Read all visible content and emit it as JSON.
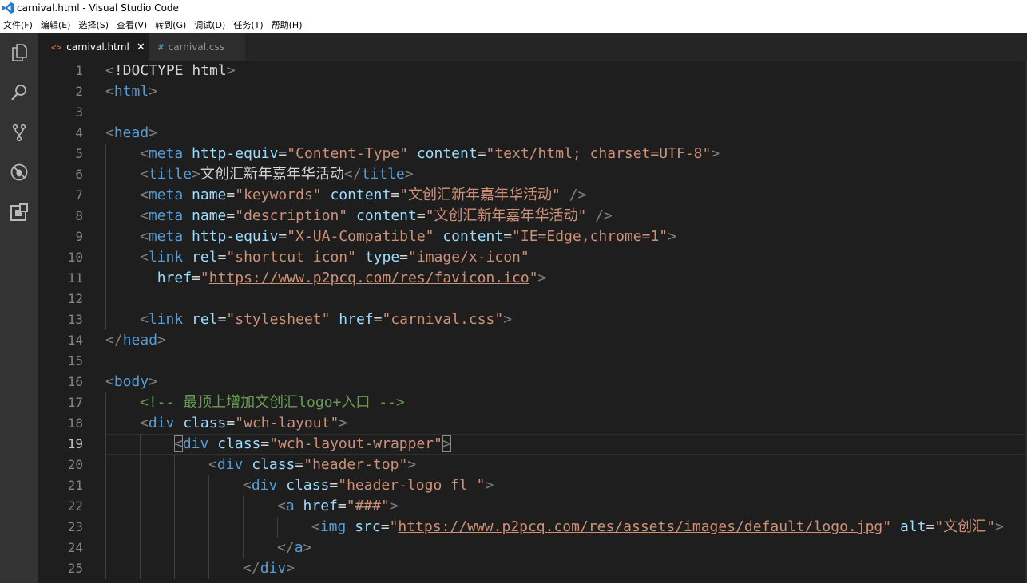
{
  "window": {
    "title": "carnival.html - Visual Studio Code"
  },
  "menu": [
    "文件(F)",
    "编辑(E)",
    "选择(S)",
    "查看(V)",
    "转到(G)",
    "调试(D)",
    "任务(T)",
    "帮助(H)"
  ],
  "activity": [
    "explorer-icon",
    "search-icon",
    "source-control-icon",
    "debug-icon",
    "extensions-icon"
  ],
  "tabs": [
    {
      "label": "carnival.html",
      "icon": "<>",
      "active": true,
      "close": "✕"
    },
    {
      "label": "carnival.css",
      "icon": "#",
      "active": false
    }
  ],
  "editor": {
    "current_line": 19,
    "lines": [
      {
        "n": "1",
        "indent": 0,
        "tokens": [
          [
            "punct",
            "<"
          ],
          [
            "text",
            "!DOCTYPE html"
          ],
          [
            "punct",
            ">"
          ]
        ]
      },
      {
        "n": "2",
        "indent": 0,
        "tokens": [
          [
            "punct",
            "<"
          ],
          [
            "tag",
            "html"
          ],
          [
            "punct",
            ">"
          ]
        ]
      },
      {
        "n": "3",
        "indent": 0,
        "tokens": []
      },
      {
        "n": "4",
        "indent": 0,
        "tokens": [
          [
            "punct",
            "<"
          ],
          [
            "tag",
            "head"
          ],
          [
            "punct",
            ">"
          ]
        ]
      },
      {
        "n": "5",
        "indent": 1,
        "tokens": [
          [
            "punct",
            "<"
          ],
          [
            "tag",
            "meta"
          ],
          [
            "text",
            " "
          ],
          [
            "attr",
            "http-equiv"
          ],
          [
            "text",
            "="
          ],
          [
            "str",
            "\"Content-Type\""
          ],
          [
            "text",
            " "
          ],
          [
            "attr",
            "content"
          ],
          [
            "text",
            "="
          ],
          [
            "str",
            "\"text/html; charset=UTF-8\""
          ],
          [
            "punct",
            ">"
          ]
        ]
      },
      {
        "n": "6",
        "indent": 1,
        "tokens": [
          [
            "punct",
            "<"
          ],
          [
            "tag",
            "title"
          ],
          [
            "punct",
            ">"
          ],
          [
            "text",
            "文创汇新年嘉年华活动"
          ],
          [
            "punct",
            "</"
          ],
          [
            "tag",
            "title"
          ],
          [
            "punct",
            ">"
          ]
        ]
      },
      {
        "n": "7",
        "indent": 1,
        "tokens": [
          [
            "punct",
            "<"
          ],
          [
            "tag",
            "meta"
          ],
          [
            "text",
            " "
          ],
          [
            "attr",
            "name"
          ],
          [
            "text",
            "="
          ],
          [
            "str",
            "\"keywords\""
          ],
          [
            "text",
            " "
          ],
          [
            "attr",
            "content"
          ],
          [
            "text",
            "="
          ],
          [
            "str",
            "\"文创汇新年嘉年华活动\""
          ],
          [
            "text",
            " "
          ],
          [
            "punct",
            "/>"
          ]
        ]
      },
      {
        "n": "8",
        "indent": 1,
        "tokens": [
          [
            "punct",
            "<"
          ],
          [
            "tag",
            "meta"
          ],
          [
            "text",
            " "
          ],
          [
            "attr",
            "name"
          ],
          [
            "text",
            "="
          ],
          [
            "str",
            "\"description\""
          ],
          [
            "text",
            " "
          ],
          [
            "attr",
            "content"
          ],
          [
            "text",
            "="
          ],
          [
            "str",
            "\"文创汇新年嘉年华活动\""
          ],
          [
            "text",
            " "
          ],
          [
            "punct",
            "/>"
          ]
        ]
      },
      {
        "n": "9",
        "indent": 1,
        "tokens": [
          [
            "punct",
            "<"
          ],
          [
            "tag",
            "meta"
          ],
          [
            "text",
            " "
          ],
          [
            "attr",
            "http-equiv"
          ],
          [
            "text",
            "="
          ],
          [
            "str",
            "\"X-UA-Compatible\""
          ],
          [
            "text",
            " "
          ],
          [
            "attr",
            "content"
          ],
          [
            "text",
            "="
          ],
          [
            "str",
            "\"IE=Edge,chrome=1\""
          ],
          [
            "punct",
            ">"
          ]
        ]
      },
      {
        "n": "10",
        "indent": 1,
        "tokens": [
          [
            "punct",
            "<"
          ],
          [
            "tag",
            "link"
          ],
          [
            "text",
            " "
          ],
          [
            "attr",
            "rel"
          ],
          [
            "text",
            "="
          ],
          [
            "str",
            "\"shortcut icon\""
          ],
          [
            "text",
            " "
          ],
          [
            "attr",
            "type"
          ],
          [
            "text",
            "="
          ],
          [
            "str",
            "\"image/x-icon\""
          ]
        ]
      },
      {
        "n": "11",
        "indent": 1,
        "tokens": [
          [
            "text",
            "  "
          ],
          [
            "attr",
            "href"
          ],
          [
            "text",
            "="
          ],
          [
            "str",
            "\""
          ],
          [
            "link",
            "https://www.p2pcq.com/res/favicon.ico"
          ],
          [
            "str",
            "\""
          ],
          [
            "punct",
            ">"
          ]
        ]
      },
      {
        "n": "12",
        "indent": 1,
        "tokens": []
      },
      {
        "n": "13",
        "indent": 1,
        "tokens": [
          [
            "punct",
            "<"
          ],
          [
            "tag",
            "link"
          ],
          [
            "text",
            " "
          ],
          [
            "attr",
            "rel"
          ],
          [
            "text",
            "="
          ],
          [
            "str",
            "\"stylesheet\""
          ],
          [
            "text",
            " "
          ],
          [
            "attr",
            "href"
          ],
          [
            "text",
            "="
          ],
          [
            "str",
            "\""
          ],
          [
            "link",
            "carnival.css"
          ],
          [
            "str",
            "\""
          ],
          [
            "punct",
            ">"
          ]
        ]
      },
      {
        "n": "14",
        "indent": 0,
        "tokens": [
          [
            "punct",
            "</"
          ],
          [
            "tag",
            "head"
          ],
          [
            "punct",
            ">"
          ]
        ]
      },
      {
        "n": "15",
        "indent": 0,
        "tokens": []
      },
      {
        "n": "16",
        "indent": 0,
        "tokens": [
          [
            "punct",
            "<"
          ],
          [
            "tag",
            "body"
          ],
          [
            "punct",
            ">"
          ]
        ]
      },
      {
        "n": "17",
        "indent": 1,
        "tokens": [
          [
            "comment",
            "<!-- 最顶上增加文创汇logo+入口 -->"
          ]
        ]
      },
      {
        "n": "18",
        "indent": 1,
        "tokens": [
          [
            "punct",
            "<"
          ],
          [
            "tag",
            "div"
          ],
          [
            "text",
            " "
          ],
          [
            "attr",
            "class"
          ],
          [
            "text",
            "="
          ],
          [
            "str",
            "\"wch-layout\""
          ],
          [
            "punct",
            ">"
          ]
        ]
      },
      {
        "n": "19",
        "indent": 2,
        "tokens": [
          [
            "bracket",
            "<"
          ],
          [
            "tag",
            "div"
          ],
          [
            "text",
            " "
          ],
          [
            "attr",
            "class"
          ],
          [
            "text",
            "="
          ],
          [
            "str",
            "\"wch-layout-wrapper\""
          ],
          [
            "bracket",
            ">"
          ]
        ]
      },
      {
        "n": "20",
        "indent": 3,
        "tokens": [
          [
            "punct",
            "<"
          ],
          [
            "tag",
            "div"
          ],
          [
            "text",
            " "
          ],
          [
            "attr",
            "class"
          ],
          [
            "text",
            "="
          ],
          [
            "str",
            "\"header-top\""
          ],
          [
            "punct",
            ">"
          ]
        ]
      },
      {
        "n": "21",
        "indent": 4,
        "tokens": [
          [
            "punct",
            "<"
          ],
          [
            "tag",
            "div"
          ],
          [
            "text",
            " "
          ],
          [
            "attr",
            "class"
          ],
          [
            "text",
            "="
          ],
          [
            "str",
            "\"header-logo fl \""
          ],
          [
            "punct",
            ">"
          ]
        ]
      },
      {
        "n": "22",
        "indent": 5,
        "tokens": [
          [
            "punct",
            "<"
          ],
          [
            "tag",
            "a"
          ],
          [
            "text",
            " "
          ],
          [
            "attr",
            "href"
          ],
          [
            "text",
            "="
          ],
          [
            "str",
            "\"###\""
          ],
          [
            "punct",
            ">"
          ]
        ]
      },
      {
        "n": "23",
        "indent": 6,
        "tokens": [
          [
            "punct",
            "<"
          ],
          [
            "tag",
            "img"
          ],
          [
            "text",
            " "
          ],
          [
            "attr",
            "src"
          ],
          [
            "text",
            "="
          ],
          [
            "str",
            "\""
          ],
          [
            "link",
            "https://www.p2pcq.com/res/assets/images/default/logo.jpg"
          ],
          [
            "str",
            "\""
          ],
          [
            "text",
            " "
          ],
          [
            "attr",
            "alt"
          ],
          [
            "text",
            "="
          ],
          [
            "str",
            "\"文创汇\""
          ],
          [
            "punct",
            ">"
          ]
        ]
      },
      {
        "n": "24",
        "indent": 5,
        "tokens": [
          [
            "punct",
            "</"
          ],
          [
            "tag",
            "a"
          ],
          [
            "punct",
            ">"
          ]
        ]
      },
      {
        "n": "25",
        "indent": 4,
        "tokens": [
          [
            "punct",
            "</"
          ],
          [
            "tag",
            "div"
          ],
          [
            "punct",
            ">"
          ]
        ]
      }
    ]
  }
}
